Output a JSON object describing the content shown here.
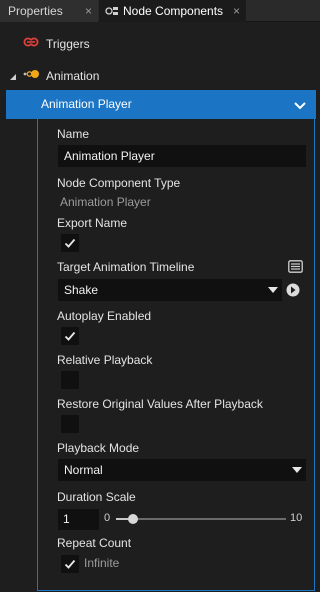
{
  "tabs": [
    {
      "label": "Properties",
      "close": "×"
    },
    {
      "label": "Node Components",
      "close": "×"
    }
  ],
  "tree": {
    "triggers_label": "Triggers",
    "animation_label": "Animation",
    "selected_label": "Animation Player"
  },
  "props": {
    "name_label": "Name",
    "name_value": "Animation Player",
    "type_label": "Node Component Type",
    "type_value": "Animation Player",
    "export_label": "Export Name",
    "export_checked": true,
    "timeline_label": "Target Animation Timeline",
    "timeline_value": "Shake",
    "autoplay_label": "Autoplay Enabled",
    "autoplay_checked": true,
    "relative_label": "Relative Playback",
    "relative_checked": false,
    "restore_label": "Restore Original Values After Playback",
    "restore_checked": false,
    "playback_mode_label": "Playback Mode",
    "playback_mode_value": "Normal",
    "duration_label": "Duration Scale",
    "duration_value": "1",
    "slider_min": "0",
    "slider_max": "10",
    "slider_fraction": 0.1,
    "repeat_label": "Repeat Count",
    "infinite_label": "Infinite",
    "infinite_checked": true
  },
  "colors": {
    "accent": "#1b74c4",
    "background": "#1e1e1e",
    "field": "#101010"
  },
  "icons": {
    "triggers": "trigger-link-icon",
    "animation": "animation-node-icon",
    "timeline_browse": "browse-list-icon",
    "timeline_goto": "goto-arrow-icon"
  }
}
